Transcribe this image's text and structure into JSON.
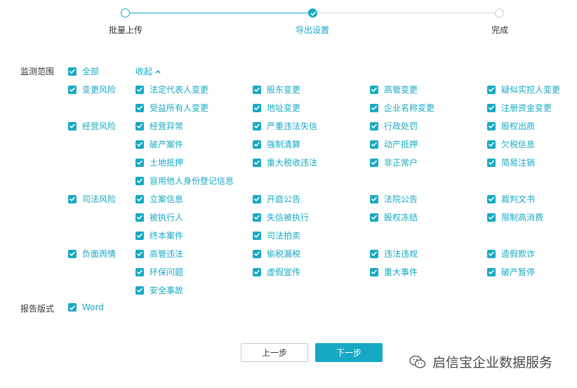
{
  "steps": [
    {
      "label": "批量上传",
      "state": "done"
    },
    {
      "label": "导出设置",
      "state": "current"
    },
    {
      "label": "完成",
      "state": "todo"
    }
  ],
  "monitor": {
    "label": "监测范围",
    "all_label": "全部",
    "collapse_label": "收起",
    "groups": [
      {
        "label": "变更风险",
        "items": [
          "法定代表人变更",
          "股东变更",
          "高管变更",
          "疑似实控人变更",
          "受益所有人变更",
          "地址变更",
          "企业名称变更",
          "注册资金变更"
        ]
      },
      {
        "label": "经营风险",
        "items": [
          "经营异常",
          "严重违法失信",
          "行政处罚",
          "股权出质",
          "破产案件",
          "强制清算",
          "动产抵押",
          "欠税信息",
          "土地抵押",
          "重大税收违法",
          "非正常户",
          "简易注销",
          "冒用他人身份登记信息"
        ]
      },
      {
        "label": "司法风险",
        "items": [
          "立案信息",
          "开庭公告",
          "法院公告",
          "裁判文书",
          "被执行人",
          "失信被执行",
          "股权冻结",
          "限制高消费",
          "终本案件",
          "司法拍卖"
        ]
      },
      {
        "label": "负面舆情",
        "items": [
          "高管违法",
          "偷税漏税",
          "违法违规",
          "造假欺诈",
          "环保问题",
          "虚假宣传",
          "重大事件",
          "破产暂停",
          "安全事故"
        ]
      }
    ]
  },
  "report": {
    "label": "报告版式",
    "option": "Word"
  },
  "buttons": {
    "prev": "上一步",
    "next": "下一步"
  },
  "watermark": {
    "text": "启信宝企业数据服务"
  },
  "colors": {
    "accent": "#17a9c3",
    "text": "#333333",
    "inactive": "#cfcfcf"
  }
}
